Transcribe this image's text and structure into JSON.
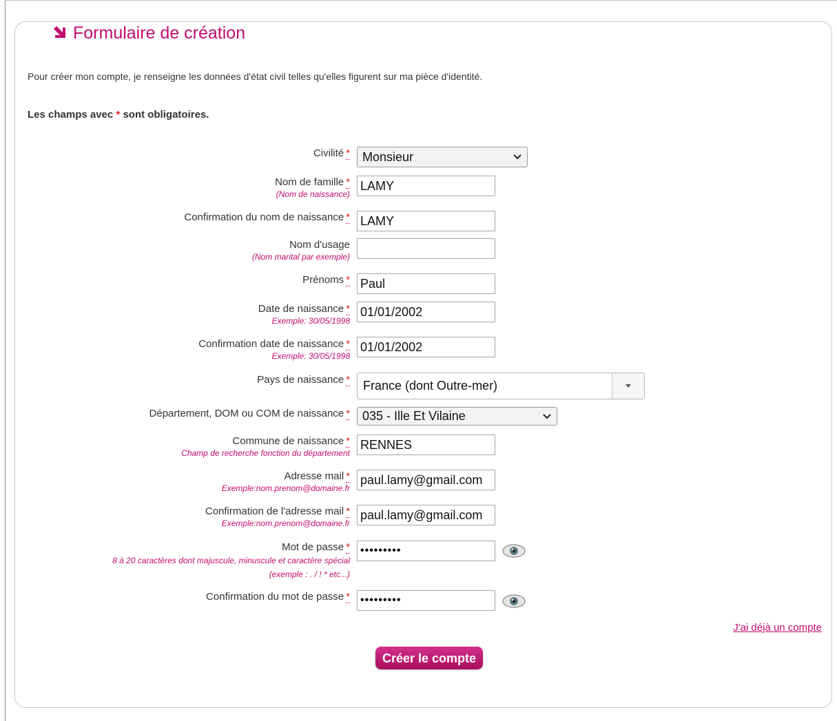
{
  "page": {
    "title": "Formulaire de création",
    "intro": "Pour créer mon compte, je renseigne les données d'état civil telles qu'elles figurent sur ma pièce d'identité.",
    "mandatory_prefix": "Les champs avec",
    "mandatory_star": "*",
    "mandatory_suffix": "sont obligatoires."
  },
  "required_marker": "*",
  "colors": {
    "accent": "#c20c6e",
    "required": "#d8251c",
    "text": "#333333"
  },
  "fields": {
    "civilite": {
      "label": "Civilité",
      "value": "Monsieur"
    },
    "nom_famille": {
      "label": "Nom de famille",
      "hint": "(Nom de naissance)",
      "value": "LAMY"
    },
    "confirm_nom": {
      "label": "Confirmation du nom de naissance",
      "value": "LAMY"
    },
    "nom_usage": {
      "label": "Nom d'usage",
      "hint": "(Nom marital par exemple)",
      "value": ""
    },
    "prenoms": {
      "label": "Prénoms",
      "value": "Paul"
    },
    "date_naissance": {
      "label": "Date de naissance",
      "hint": "Exemple: 30/05/1998",
      "value": "01/01/2002"
    },
    "confirm_date": {
      "label": "Confirmation date de naissance",
      "hint": "Exemple: 30/05/1998",
      "value": "01/01/2002"
    },
    "pays": {
      "label": "Pays de naissance",
      "value": "France (dont Outre-mer)"
    },
    "departement": {
      "label": "Département, DOM ou COM de naissance",
      "value": "035 - Ille Et Vilaine"
    },
    "commune": {
      "label": "Commune de naissance",
      "hint": "Champ de recherche fonction du département",
      "value": "RENNES"
    },
    "email": {
      "label": "Adresse mail",
      "hint": "Exemple:nom.prenom@domaine.fr",
      "value": "paul.lamy@gmail.com"
    },
    "confirm_email": {
      "label": "Confirmation de l'adresse mail",
      "hint": "Exemple:nom.prenom@domaine.fr",
      "value": "paul.lamy@gmail.com"
    },
    "password": {
      "label": "Mot de passe",
      "hint1": "8 à 20 caractères dont majuscule, minuscule et caractère spécial",
      "hint2": "(exemple : . / ! * etc...)",
      "value": "•••••••••"
    },
    "confirm_password": {
      "label": "Confirmation du mot de passe",
      "value": "•••••••••"
    }
  },
  "icons": {
    "title": "corner-arrow-icon",
    "reveal": "eye-icon"
  },
  "links": {
    "already_account": "J'ai déjà un compte"
  },
  "buttons": {
    "submit": "Créer le compte"
  }
}
